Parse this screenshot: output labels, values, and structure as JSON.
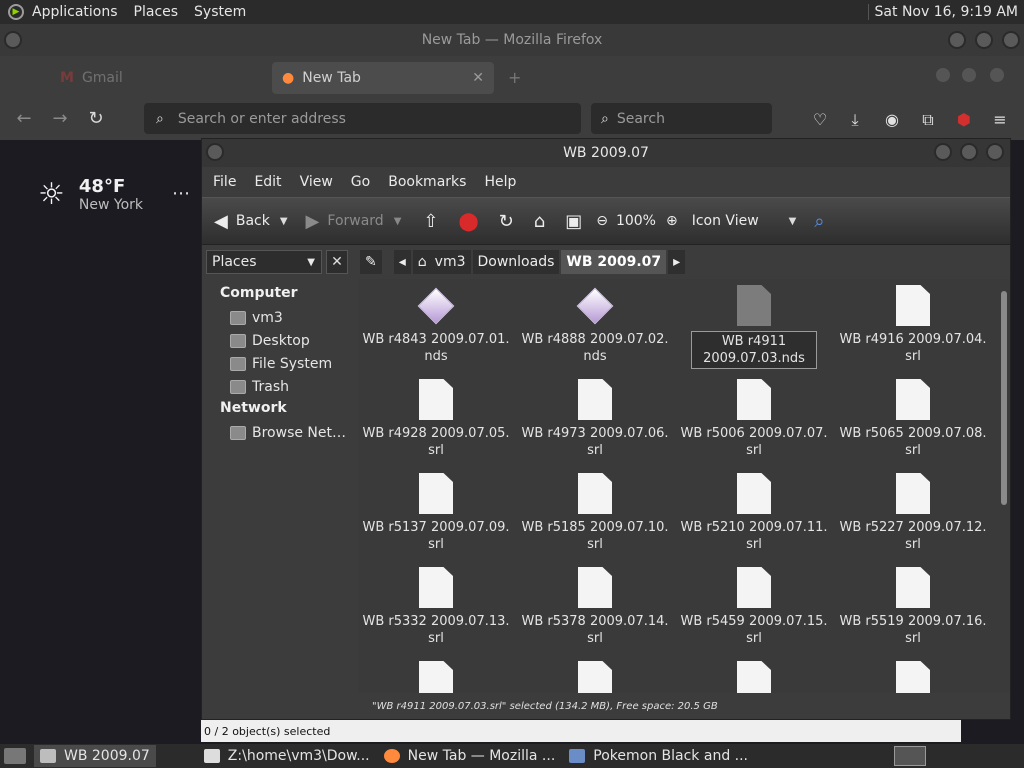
{
  "top_panel": {
    "menus": [
      "Applications",
      "Places",
      "System"
    ],
    "clock": "Sat Nov 16,  9:19 AM"
  },
  "firefox": {
    "title": "New Tab — Mozilla Firefox",
    "tabs": [
      {
        "label": "Gmail",
        "icon": "gmail-icon"
      },
      {
        "label": "New Tab",
        "icon": "firefox-icon"
      }
    ],
    "url_placeholder": "Search or enter address",
    "search_placeholder": "Search",
    "weather": {
      "temp": "48°F",
      "city": "New York"
    }
  },
  "file_manager": {
    "title": "WB 2009.07",
    "menus": [
      "File",
      "Edit",
      "View",
      "Go",
      "Bookmarks",
      "Help"
    ],
    "toolbar": {
      "back": "Back",
      "forward": "Forward",
      "zoom": "100%",
      "view_mode": "Icon View"
    },
    "side_pane_label": "Places",
    "breadcrumbs": [
      "vm3",
      "Downloads",
      "WB 2009.07"
    ],
    "sidebar": {
      "computer_header": "Computer",
      "computer_items": [
        "vm3",
        "Desktop",
        "File System",
        "Trash"
      ],
      "network_header": "Network",
      "network_items": [
        "Browse Net…"
      ]
    },
    "files": [
      {
        "name": "WB r4843 2009.07.01.\nnds",
        "type": "nds"
      },
      {
        "name": "WB r4888 2009.07.02.\nnds",
        "type": "nds"
      },
      {
        "name": "WB r4911\n2009.07.03.nds",
        "type": "renaming"
      },
      {
        "name": "WB r4916 2009.07.04.\nsrl",
        "type": "srl"
      },
      {
        "name": "WB r4928 2009.07.05.\nsrl",
        "type": "srl"
      },
      {
        "name": "WB r4973 2009.07.06.\nsrl",
        "type": "srl"
      },
      {
        "name": "WB r5006 2009.07.07.\nsrl",
        "type": "srl"
      },
      {
        "name": "WB r5065 2009.07.08.\nsrl",
        "type": "srl"
      },
      {
        "name": "WB r5137 2009.07.09.\nsrl",
        "type": "srl"
      },
      {
        "name": "WB r5185 2009.07.10.\nsrl",
        "type": "srl"
      },
      {
        "name": "WB r5210 2009.07.11.\nsrl",
        "type": "srl"
      },
      {
        "name": "WB r5227 2009.07.12.\nsrl",
        "type": "srl"
      },
      {
        "name": "WB r5332 2009.07.13.\nsrl",
        "type": "srl"
      },
      {
        "name": "WB r5378 2009.07.14.\nsrl",
        "type": "srl"
      },
      {
        "name": "WB r5459 2009.07.15.\nsrl",
        "type": "srl"
      },
      {
        "name": "WB r5519 2009.07.16.\nsrl",
        "type": "srl"
      },
      {
        "name": "",
        "type": "srl"
      },
      {
        "name": "",
        "type": "srl"
      },
      {
        "name": "",
        "type": "srl"
      },
      {
        "name": "",
        "type": "srl"
      }
    ],
    "status": "\"WB r4911 2009.07.03.srl\" selected (134.2 MB), Free space: 20.5 GB"
  },
  "ff_status": "0 / 2 object(s) selected",
  "taskbar": {
    "items": [
      {
        "label": "WB 2009.07",
        "active": true
      },
      {
        "label": "Z:\\home\\vm3\\Dow...",
        "active": false
      },
      {
        "label": "New Tab — Mozilla ...",
        "active": false
      },
      {
        "label": "Pokemon Black and ...",
        "active": false
      }
    ]
  }
}
